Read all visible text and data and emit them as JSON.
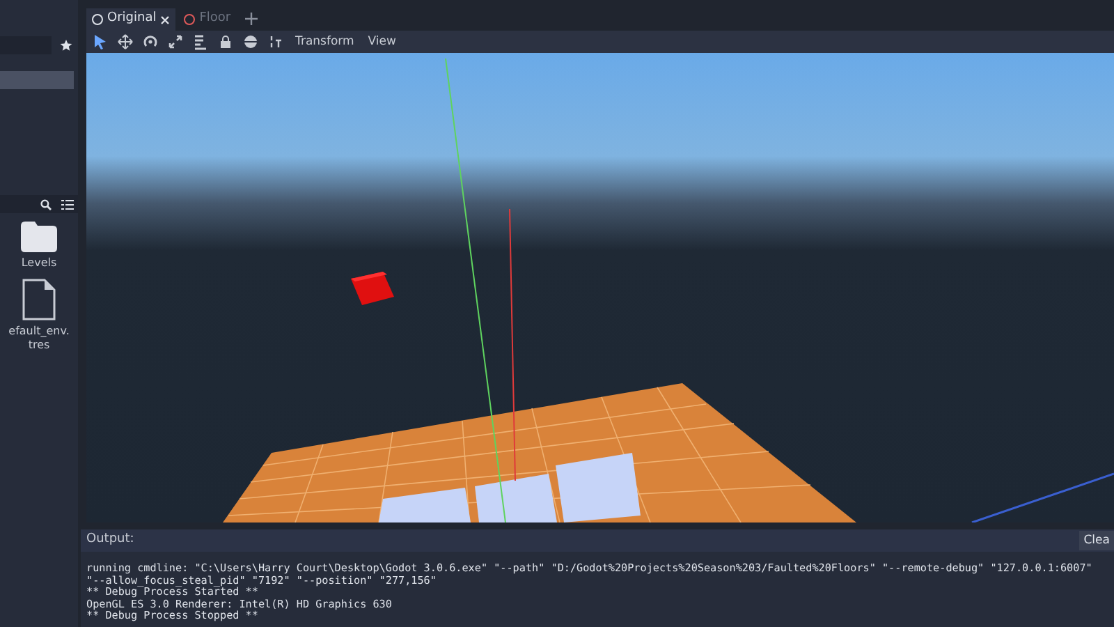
{
  "scene_tabs": [
    {
      "label": "Original",
      "selected": true
    },
    {
      "label": "Floor",
      "selected": false
    }
  ],
  "toolbar": {
    "tools": [
      {
        "kind": "select",
        "selected": true
      },
      {
        "kind": "move",
        "selected": false
      },
      {
        "kind": "rotate",
        "selected": false
      },
      {
        "kind": "scale",
        "selected": false
      },
      {
        "kind": "list",
        "selected": false
      },
      {
        "kind": "lock",
        "selected": false
      },
      {
        "kind": "sphere",
        "selected": false
      },
      {
        "kind": "snap",
        "selected": false
      }
    ],
    "menus": [
      "Transform",
      "View"
    ]
  },
  "filesystem": {
    "items": [
      {
        "kind": "folder",
        "label": "Levels"
      },
      {
        "kind": "file",
        "label": "efault_env.tres"
      }
    ]
  },
  "output": {
    "title": "Output:",
    "clear_button": "Clea",
    "lines": [
      "running cmdline: \"C:\\Users\\Harry Court\\Desktop\\Godot 3.0.6.exe\" \"--path\" \"D:/Godot%20Projects%20Season%203/Faulted%20Floors\" \"--remote-debug\" \"127.0.0.1:6007\"",
      "\"--allow_focus_steal_pid\" \"7192\" \"--position\" \"277,156\"",
      "** Debug Process Started **",
      "OpenGL ES 3.0 Renderer: Intel(R) HD Graphics 630",
      "** Debug Process Stopped **"
    ]
  }
}
